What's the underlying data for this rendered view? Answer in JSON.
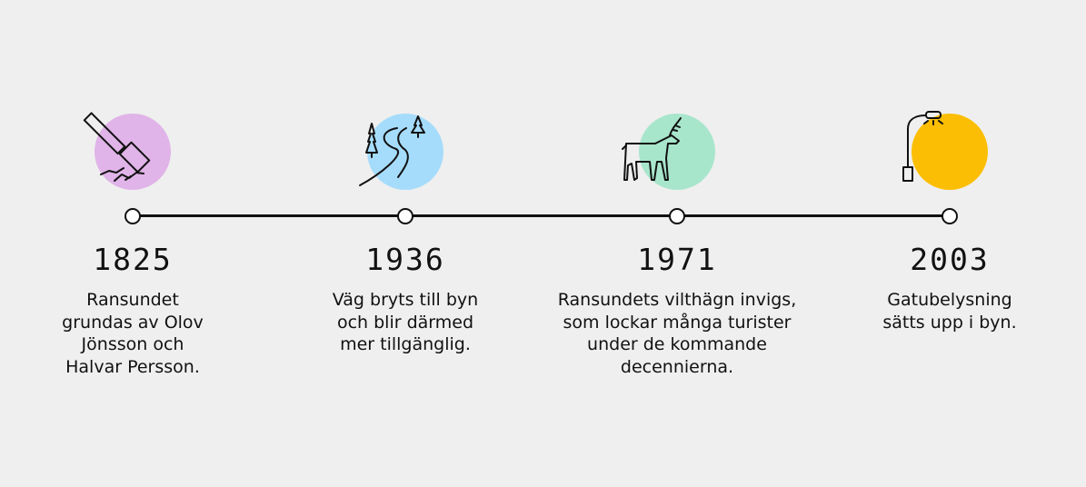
{
  "events": [
    {
      "year": "1825",
      "lines": [
        "Ransundet",
        "grundas av Olov",
        "Jönsson och",
        "Halvar Persson."
      ],
      "icon": "sledgehammer-icon",
      "color": "#e0b4e8"
    },
    {
      "year": "1936",
      "lines": [
        "Väg bryts till byn",
        "och blir därmed",
        "mer tillgänglig."
      ],
      "icon": "road-trees-icon",
      "color": "#a6dcfb"
    },
    {
      "year": "1971",
      "lines": [
        "Ransundets vilthägn invigs,",
        "som lockar många turister",
        "under de kommande",
        "decennierna."
      ],
      "icon": "deer-icon",
      "color": "#a8e6cc"
    },
    {
      "year": "2003",
      "lines": [
        "Gatubelysning",
        "sätts upp i byn."
      ],
      "icon": "streetlight-icon",
      "color": "#fbbe04"
    }
  ]
}
